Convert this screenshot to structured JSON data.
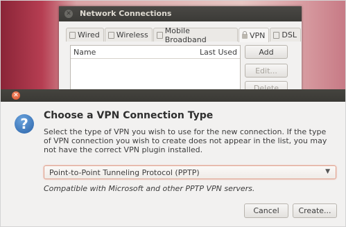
{
  "bg_window": {
    "title": "Network Connections",
    "tabs": [
      {
        "label": "Wired",
        "icon": "network-wired-icon"
      },
      {
        "label": "Wireless",
        "icon": "network-wireless-icon"
      },
      {
        "label": "Mobile Broadband",
        "icon": "mobile-broadband-icon"
      },
      {
        "label": "VPN",
        "icon": "lock-icon",
        "active": true
      },
      {
        "label": "DSL",
        "icon": "dsl-icon"
      }
    ],
    "columns": [
      "Name",
      "Last Used"
    ],
    "buttons": {
      "add": "Add",
      "edit": "Edit...",
      "delete": "Delete"
    }
  },
  "dialog": {
    "heading": "Choose a VPN Connection Type",
    "description": "Select the type of VPN you wish to use for the new connection.  If the type of VPN connection you wish to create does not appear in the list, you may not have the correct VPN plugin installed.",
    "vpn_type_selected": "Point-to-Point Tunneling Protocol (PPTP)",
    "note": "Compatible with Microsoft and other PPTP VPN servers.",
    "buttons": {
      "cancel": "Cancel",
      "create": "Create..."
    },
    "icon": "question-icon"
  },
  "colors": {
    "close_accent": "#e05a32",
    "focus_border": "#e0a08e"
  }
}
